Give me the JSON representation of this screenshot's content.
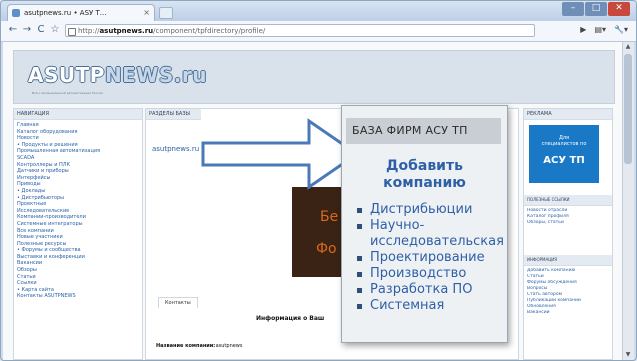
{
  "browser": {
    "tab_title": "asutpnews.ru • ASУ Т...",
    "tab_close": "×",
    "url_prefix": "http://",
    "url_domain": "asutpnews.ru",
    "url_path": "/component/tpfdirectory/profile/",
    "win_min": "–",
    "win_max": "□",
    "win_close": "✕",
    "back_icon": "←",
    "forward_icon": "→",
    "reload_icon": "C",
    "star_icon": "☆",
    "tools": [
      "▶",
      "▤▾",
      "🔧▾"
    ]
  },
  "site": {
    "logo_a": "ASUTP",
    "logo_b": "NEWS.ru",
    "tagline": "Всё о промышленной автоматизации России"
  },
  "left": {
    "header": "НАВИГАЦИЯ",
    "items": [
      "Главная",
      "Каталог оборудования",
      "Новости",
      "• Продукты и решения",
      "  Промышленная автоматизация",
      "  SCADA",
      "  Контроллеры и ПЛК",
      "  Датчики и приборы",
      "  Интерфейсы",
      "  Приводы",
      "• Доклады",
      "• Дистрибьюторы",
      "  Проектные",
      "  Исследовательские",
      "  Компании-производители",
      "  Системные интеграторы",
      "  Все компании",
      "  Новые участники",
      "Полезные ресурсы",
      "• Форумы и сообщества",
      "  Выставки и конференции",
      "  Вакансии",
      "  Обзоры",
      "  Статьи",
      "Ссылки",
      "• Карта сайта",
      "  Контакты ASUTPNEWS"
    ]
  },
  "center": {
    "header": "РАЗДЕЛЫ БАЗЫ",
    "profile_link": "asutpnews.ru страница профиля",
    "overlay_1": "Бе",
    "overlay_2": "Фо",
    "tab_contacts": "Контакты",
    "info_title": "Информация о Ваш",
    "row_label": "Название компании:",
    "row_value": "asutpnews"
  },
  "right": {
    "header": "РЕКЛАМА",
    "promo_l1": "Для",
    "promo_l2": "специалистов по",
    "promo_big": "АСУ ТП",
    "block2_header": "ПОЛЕЗНЫЕ ССЫЛКИ",
    "block2_items": [
      "Новости отрасли",
      "Каталог профиля",
      "Обзоры, статьи"
    ],
    "block3_header": "ИНФОРМАЦИЯ",
    "block3_items": [
      "Добавить компанию",
      "Статьи",
      "Форумы обсуждения",
      "Вопросы",
      "Стать автором",
      "Публикации компании",
      "Обновления",
      "Вакансии"
    ]
  },
  "popup": {
    "title": "БАЗА ФИРМ АСУ ТП",
    "add_company": "Добавить компанию",
    "items": [
      "Дистрибьюции",
      "Научно-исследовательская",
      "Проектирование",
      "Производство",
      "Разработка ПО",
      "Системная"
    ]
  },
  "colors": {
    "accent": "#2f5fa7",
    "promo_bg": "#1979c7",
    "arrow_stroke": "#4a79b8"
  }
}
